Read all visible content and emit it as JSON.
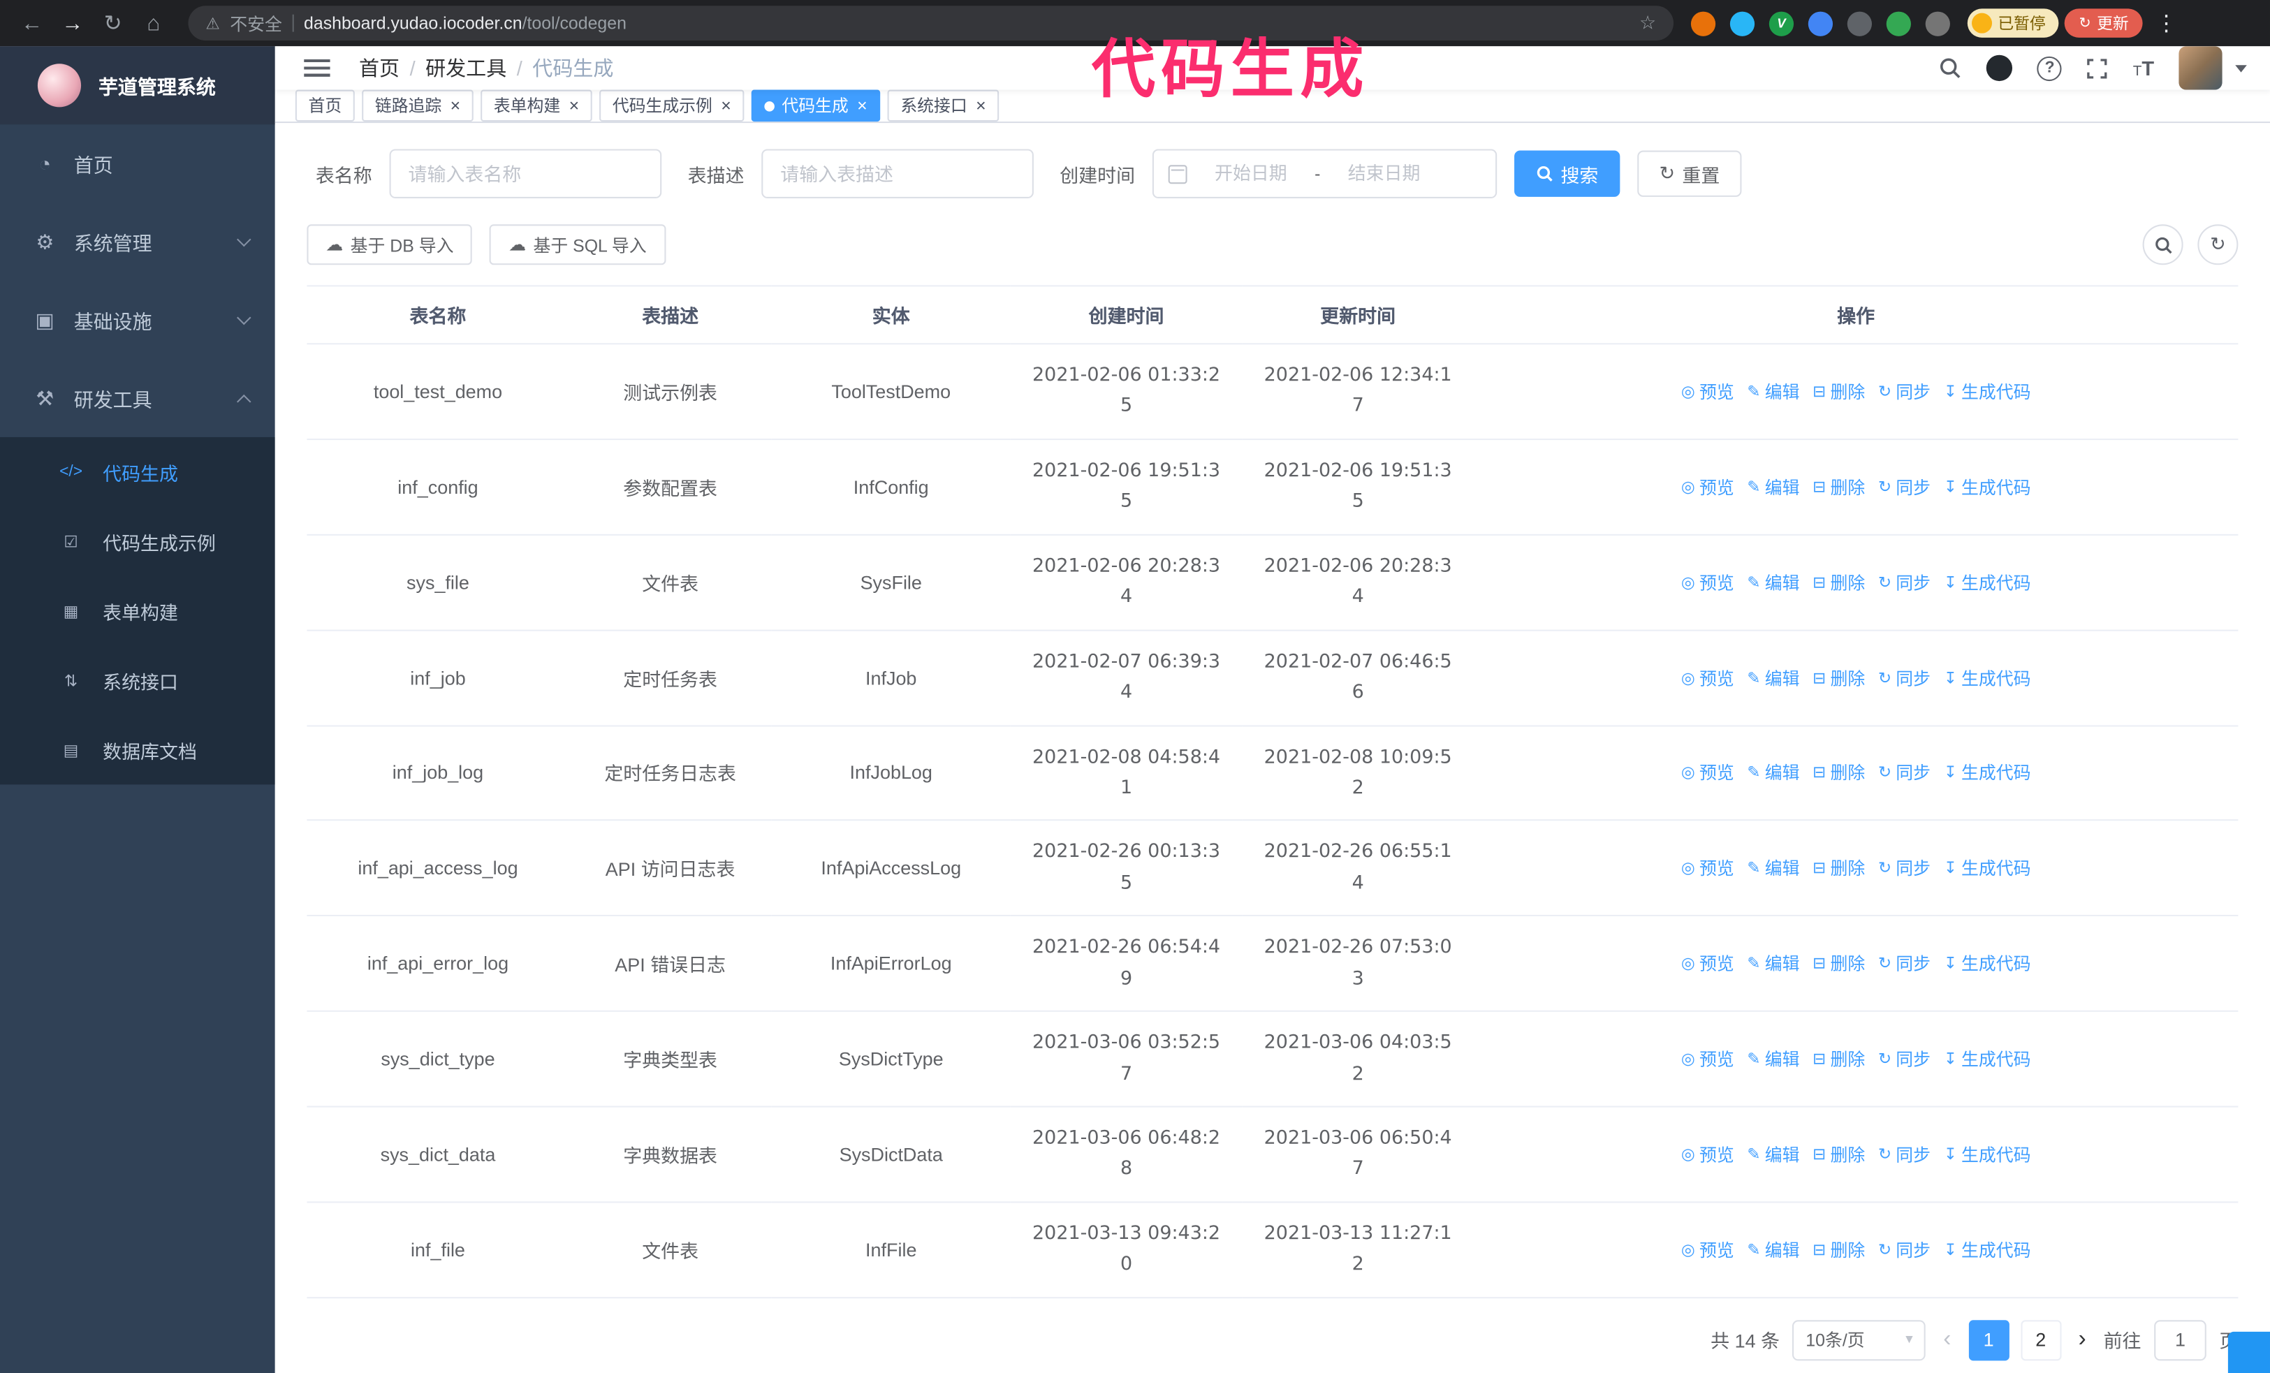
{
  "annotation": {
    "text": "代码生成",
    "color": "#fb2d6e"
  },
  "colors": {
    "primary": "#409eff",
    "sidebar_bg": "#304156",
    "submenu_bg": "#1f2d3d",
    "active_tab_bg": "#409eff",
    "update_button_bg": "#e35d4f"
  },
  "browser": {
    "security_label": "不安全",
    "url_host": "dashboard.yudao.iocoder.cn",
    "url_path": "/tool/codegen",
    "paused_badge": "已暂停",
    "update_label": "更新",
    "extensions": [
      {
        "name": "extension-orange-icon",
        "color": "#e8710a",
        "glyph": ""
      },
      {
        "name": "extension-water-icon",
        "color": "#29b6f6",
        "glyph": ""
      },
      {
        "name": "extension-check-icon",
        "color": "#1e9e4a",
        "glyph": "V"
      },
      {
        "name": "extension-people-icon",
        "color": "#4285f4",
        "glyph": ""
      },
      {
        "name": "extension-gray-icon",
        "color": "#5f6368",
        "glyph": ""
      },
      {
        "name": "extension-leaf-icon",
        "color": "#34a853",
        "glyph": ""
      },
      {
        "name": "extension-puzzle-icon",
        "color": "#757575",
        "glyph": ""
      }
    ]
  },
  "icons": {
    "back": "←",
    "forward": "→",
    "reload": "↻",
    "home": "⌂",
    "warning": "⚠",
    "star": "☆",
    "menu_dots": "⋮",
    "crumb_sep": "/",
    "help": "?",
    "font_small": "T",
    "font_large": "T",
    "close": "×",
    "reset": "↻",
    "upload": "☁",
    "caret_down": "▾",
    "prev": "‹",
    "next": "›"
  },
  "sidebar": {
    "title": "芋道管理系统",
    "menu": [
      {
        "label": "首页",
        "icon": "home-icon",
        "glyph": "◔"
      },
      {
        "label": "系统管理",
        "icon": "system-settings-icon",
        "glyph": "⚙",
        "expandable": true
      },
      {
        "label": "基础设施",
        "icon": "infrastructure-icon",
        "glyph": "▣",
        "expandable": true
      },
      {
        "label": "研发工具",
        "icon": "dev-tools-icon",
        "glyph": "⚒",
        "expandable": true,
        "expanded": true
      }
    ],
    "submenu": [
      {
        "label": "代码生成",
        "icon": "code-generate-icon",
        "glyph": "</>",
        "active": true
      },
      {
        "label": "代码生成示例",
        "icon": "code-example-icon",
        "glyph": "☑"
      },
      {
        "label": "表单构建",
        "icon": "form-builder-icon",
        "glyph": "▦"
      },
      {
        "label": "系统接口",
        "icon": "system-api-icon",
        "glyph": "⇅"
      },
      {
        "label": "数据库文档",
        "icon": "db-doc-icon",
        "glyph": "▤"
      }
    ]
  },
  "header": {
    "breadcrumb": [
      "首页",
      "研发工具",
      "代码生成"
    ]
  },
  "tabs": [
    {
      "label": "首页"
    },
    {
      "label": "链路追踪",
      "closable": true
    },
    {
      "label": "表单构建",
      "closable": true
    },
    {
      "label": "代码生成示例",
      "closable": true
    },
    {
      "label": "代码生成",
      "closable": true,
      "active": true
    },
    {
      "label": "系统接口",
      "closable": true
    }
  ],
  "filters": {
    "name_label": "表名称",
    "name_placeholder": "请输入表名称",
    "desc_label": "表描述",
    "desc_placeholder": "请输入表描述",
    "time_label": "创建时间",
    "start_placeholder": "开始日期",
    "range_separator": "-",
    "end_placeholder": "结束日期",
    "search_label": "搜索",
    "reset_label": "重置"
  },
  "toolbar": {
    "import_db_label": "基于 DB 导入",
    "import_sql_label": "基于 SQL 导入"
  },
  "table": {
    "columns": [
      "表名称",
      "表描述",
      "实体",
      "创建时间",
      "更新时间",
      "操作"
    ],
    "actions": [
      {
        "name": "preview-action",
        "label": "预览",
        "icon": "eye-icon",
        "glyph": "◎"
      },
      {
        "name": "edit-action",
        "label": "编辑",
        "icon": "edit-icon",
        "glyph": "✎"
      },
      {
        "name": "delete-action",
        "label": "删除",
        "icon": "delete-icon",
        "glyph": "⊟"
      },
      {
        "name": "sync-action",
        "label": "同步",
        "icon": "sync-icon",
        "glyph": "↻"
      },
      {
        "name": "generate-code-action",
        "label": "生成代码",
        "icon": "download-icon",
        "glyph": "↧"
      }
    ],
    "rows": [
      {
        "name": "tool_test_demo",
        "desc": "测试示例表",
        "entity": "ToolTestDemo",
        "created": "2021-02-06 01:33:25",
        "updated": "2021-02-06 12:34:17"
      },
      {
        "name": "inf_config",
        "desc": "参数配置表",
        "entity": "InfConfig",
        "created": "2021-02-06 19:51:35",
        "updated": "2021-02-06 19:51:35"
      },
      {
        "name": "sys_file",
        "desc": "文件表",
        "entity": "SysFile",
        "created": "2021-02-06 20:28:34",
        "updated": "2021-02-06 20:28:34"
      },
      {
        "name": "inf_job",
        "desc": "定时任务表",
        "entity": "InfJob",
        "created": "2021-02-07 06:39:34",
        "updated": "2021-02-07 06:46:56"
      },
      {
        "name": "inf_job_log",
        "desc": "定时任务日志表",
        "entity": "InfJobLog",
        "created": "2021-02-08 04:58:41",
        "updated": "2021-02-08 10:09:52"
      },
      {
        "name": "inf_api_access_log",
        "desc": "API 访问日志表",
        "entity": "InfApiAccessLog",
        "created": "2021-02-26 00:13:35",
        "updated": "2021-02-26 06:55:14"
      },
      {
        "name": "inf_api_error_log",
        "desc": "API 错误日志",
        "entity": "InfApiErrorLog",
        "created": "2021-02-26 06:54:49",
        "updated": "2021-02-26 07:53:03"
      },
      {
        "name": "sys_dict_type",
        "desc": "字典类型表",
        "entity": "SysDictType",
        "created": "2021-03-06 03:52:57",
        "updated": "2021-03-06 04:03:52"
      },
      {
        "name": "sys_dict_data",
        "desc": "字典数据表",
        "entity": "SysDictData",
        "created": "2021-03-06 06:48:28",
        "updated": "2021-03-06 06:50:47"
      },
      {
        "name": "inf_file",
        "desc": "文件表",
        "entity": "InfFile",
        "created": "2021-03-13 09:43:20",
        "updated": "2021-03-13 11:27:12"
      }
    ]
  },
  "pagination": {
    "total_label": "共 14 条",
    "page_size_label": "10条/页",
    "pages": [
      {
        "label": "1",
        "active": true
      },
      {
        "label": "2"
      }
    ],
    "goto_label": "前往",
    "goto_value": "1",
    "page_unit_label": "页"
  }
}
